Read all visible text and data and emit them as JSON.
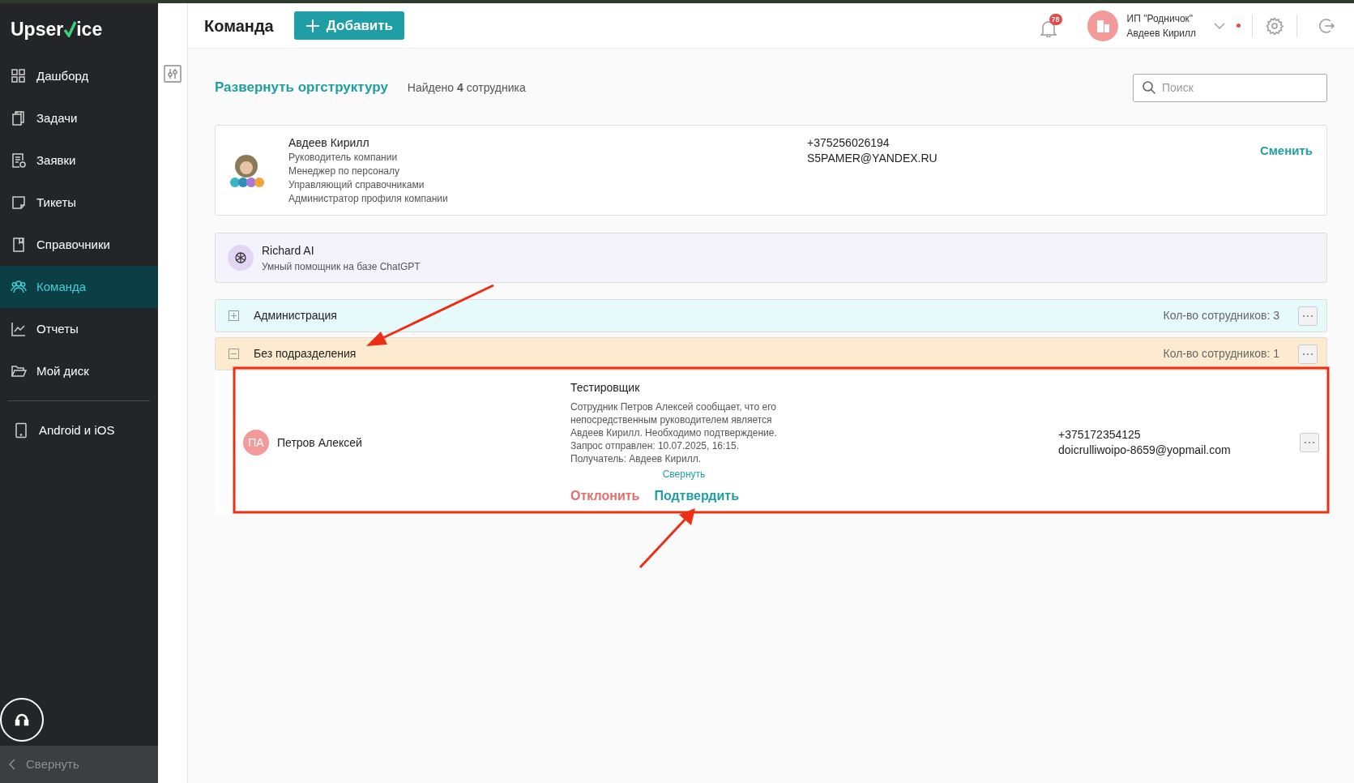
{
  "logo": {
    "before": "Upser",
    "after": "ice"
  },
  "sidebar": {
    "items": [
      {
        "label": "Дашборд",
        "selected": false
      },
      {
        "label": "Задачи",
        "selected": false
      },
      {
        "label": "Заявки",
        "selected": false
      },
      {
        "label": "Тикеты",
        "selected": false
      },
      {
        "label": "Справочники",
        "selected": false
      },
      {
        "label": "Команда",
        "selected": true
      },
      {
        "label": "Отчеты",
        "selected": false
      },
      {
        "label": "Мой диск",
        "selected": false
      }
    ],
    "apps": {
      "label": "Android и iOS"
    },
    "collapse": {
      "label": "Свернуть"
    }
  },
  "header": {
    "title": "Команда",
    "add_button": "Добавить",
    "notifications": "78",
    "company": "ИП \"Родничок\"",
    "user": "Авдеев Кирилл"
  },
  "toolbar": {
    "expand_link": "Развернуть оргструктуру",
    "found": "Найдено **4** сотрудника",
    "search": {
      "placeholder": "Поиск"
    }
  },
  "manager": {
    "name": "Авдеев Кирилл",
    "roles": [
      "Руководитель компании",
      "Менеджер по персоналу",
      "Управляющий справочниками",
      "Администратор профиля компании"
    ],
    "phone": "+375256026194",
    "email": "S5PAMER@YANDEX.RU",
    "change": "Сменить"
  },
  "assistant": {
    "name": "Richard AI",
    "description": "Умный помощник на базе ChatGPT"
  },
  "departments": [
    {
      "name": "Администрация",
      "count": "Кол-во сотрудников: 3",
      "expanded": false,
      "color": "#e6f9fb"
    },
    {
      "name": "Без подразделения",
      "count": "Кол-во сотрудников: 1",
      "expanded": true,
      "color": "#fdebd0",
      "employees": [
        {
          "initials": "ПА",
          "name": "Петров Алексей",
          "role": "Тестировщик",
          "message_lines": [
            "Сотрудник Петров Алексей сообщает, что его",
            "непосредственным руководителем является",
            "Авдеев Кирилл. Необходимо подтверждение.",
            "Запрос отправлен: 10.07.2025, 16:15.",
            "Получатель: Авдеев Кирилл."
          ],
          "collapse": "Свернуть",
          "reject": "Отклонить",
          "confirm": "Подтвердить",
          "phone": "+375172354125",
          "email": "doicrulliwoipo-8659@yopmail.com"
        }
      ]
    }
  ]
}
